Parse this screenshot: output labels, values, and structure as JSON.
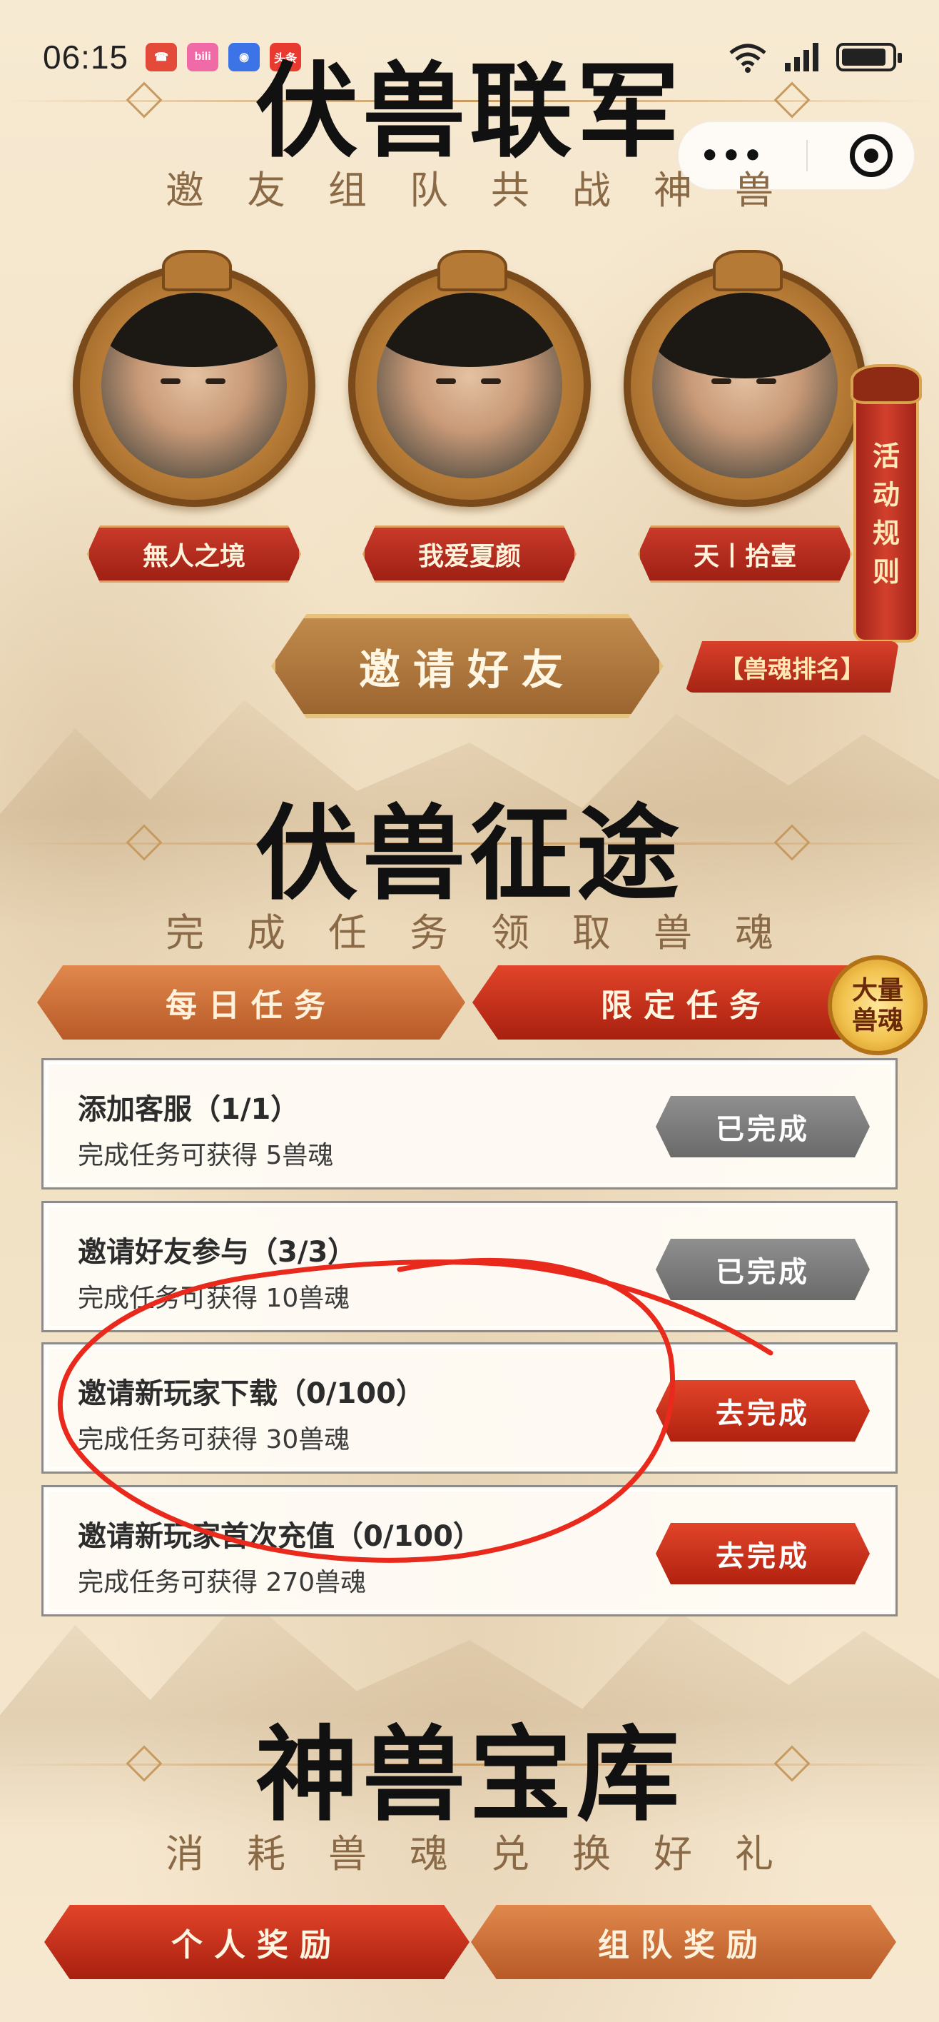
{
  "status_bar": {
    "time": "06:15",
    "apps": [
      {
        "icon": "phone-app-icon",
        "color": "#e34a3a",
        "label": ""
      },
      {
        "icon": "bilibili-icon",
        "color": "#f06aa8",
        "label": "bili"
      },
      {
        "icon": "browser-app-icon",
        "color": "#3c74e8",
        "label": ""
      },
      {
        "icon": "toutiao-icon",
        "color": "#e83a2f",
        "label": "头条"
      }
    ]
  },
  "capsule": {
    "more_label": "•••"
  },
  "section1": {
    "title": "伏兽联军",
    "subtitle": "邀友组队共战神兽"
  },
  "team_members": [
    {
      "name": "無人之境"
    },
    {
      "name": "我爱夏颜"
    },
    {
      "name": "天丨拾壹"
    }
  ],
  "rules_banner": {
    "label": [
      "活",
      "动",
      "规",
      "则"
    ]
  },
  "rank_tag": {
    "label": "【兽魂排名】"
  },
  "invite_button": {
    "label": "邀请好友"
  },
  "section2": {
    "title": "伏兽征途",
    "subtitle": "完成任务领取兽魂"
  },
  "task_tabs": [
    {
      "label": "每日任务",
      "active": false
    },
    {
      "label": "限定任务",
      "active": true
    }
  ],
  "badge": {
    "line1": "大量",
    "line2": "兽魂"
  },
  "tasks": [
    {
      "title": "添加客服（1/1）",
      "reward": "完成任务可获得 5兽魂",
      "button": "已完成",
      "status": "done"
    },
    {
      "title": "邀请好友参与（3/3）",
      "reward": "完成任务可获得 10兽魂",
      "button": "已完成",
      "status": "done"
    },
    {
      "title": "邀请新玩家下载（0/100）",
      "reward": "完成任务可获得 30兽魂",
      "button": "去完成",
      "status": "todo"
    },
    {
      "title": "邀请新玩家首次充值（0/100）",
      "reward": "完成任务可获得 270兽魂",
      "button": "去完成",
      "status": "todo"
    }
  ],
  "section3": {
    "title": "神兽宝库",
    "subtitle": "消耗兽魂兑换好礼"
  },
  "reward_tabs": [
    {
      "label": "个人奖励",
      "active": true
    },
    {
      "label": "组队奖励",
      "active": false
    }
  ],
  "colors": {
    "accent_red": "#c93a2a",
    "gold": "#c79a60",
    "done_gray": "#7a7a7a",
    "annotation_red": "#e8291c"
  }
}
